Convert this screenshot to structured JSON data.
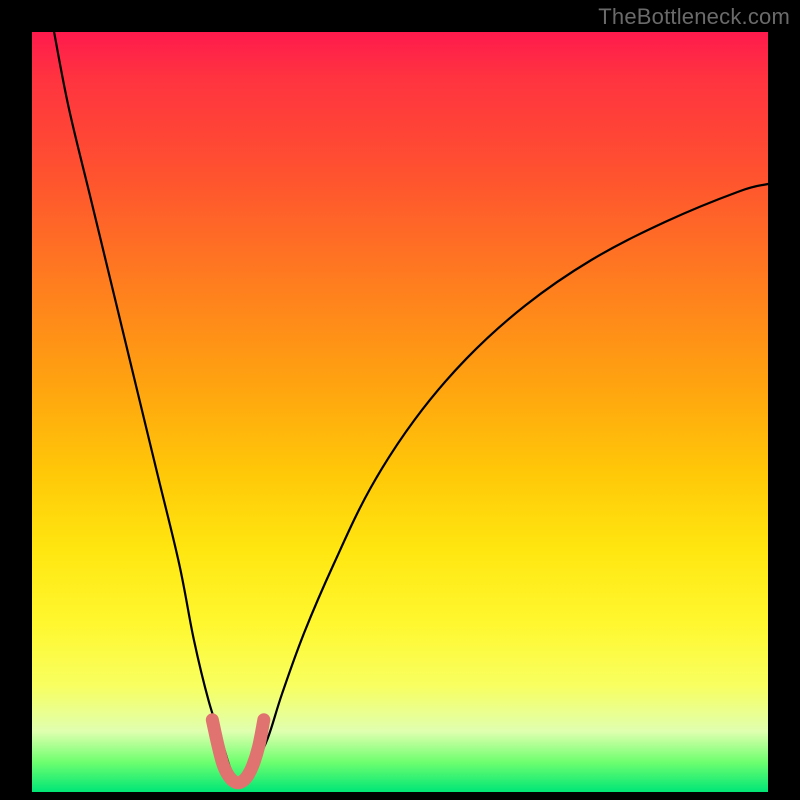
{
  "watermark": "TheBottleneck.com",
  "colors": {
    "frame": "#000000",
    "curve_stroke": "#000000",
    "highlight_stroke": "#e0736f",
    "gradient_top": "#ff1a4d",
    "gradient_bottom": "#00e676"
  },
  "chart_data": {
    "type": "line",
    "title": "",
    "xlabel": "",
    "ylabel": "",
    "xlim": [
      0,
      100
    ],
    "ylim": [
      0,
      100
    ],
    "series": [
      {
        "name": "bottleneck-curve",
        "x": [
          3,
          5,
          8,
          11,
          14,
          17,
          20,
          22,
          24,
          26,
          27,
          28,
          29,
          30,
          32,
          34,
          37,
          41,
          46,
          52,
          59,
          67,
          76,
          86,
          96,
          100
        ],
        "values": [
          100,
          90,
          78,
          66,
          54,
          42,
          30,
          20,
          12,
          6,
          3,
          1.5,
          1.5,
          3,
          7,
          13,
          21,
          30,
          40,
          49,
          57,
          64,
          70,
          75,
          79,
          80
        ]
      },
      {
        "name": "minimum-highlight",
        "x": [
          24.5,
          25.3,
          26.0,
          26.8,
          27.6,
          28.4,
          29.2,
          30.0,
          30.8,
          31.5
        ],
        "values": [
          9.5,
          6.0,
          3.5,
          2.0,
          1.3,
          1.3,
          2.0,
          3.5,
          6.0,
          9.5
        ]
      }
    ],
    "minimum": {
      "x": 28,
      "value": 1.3
    }
  }
}
